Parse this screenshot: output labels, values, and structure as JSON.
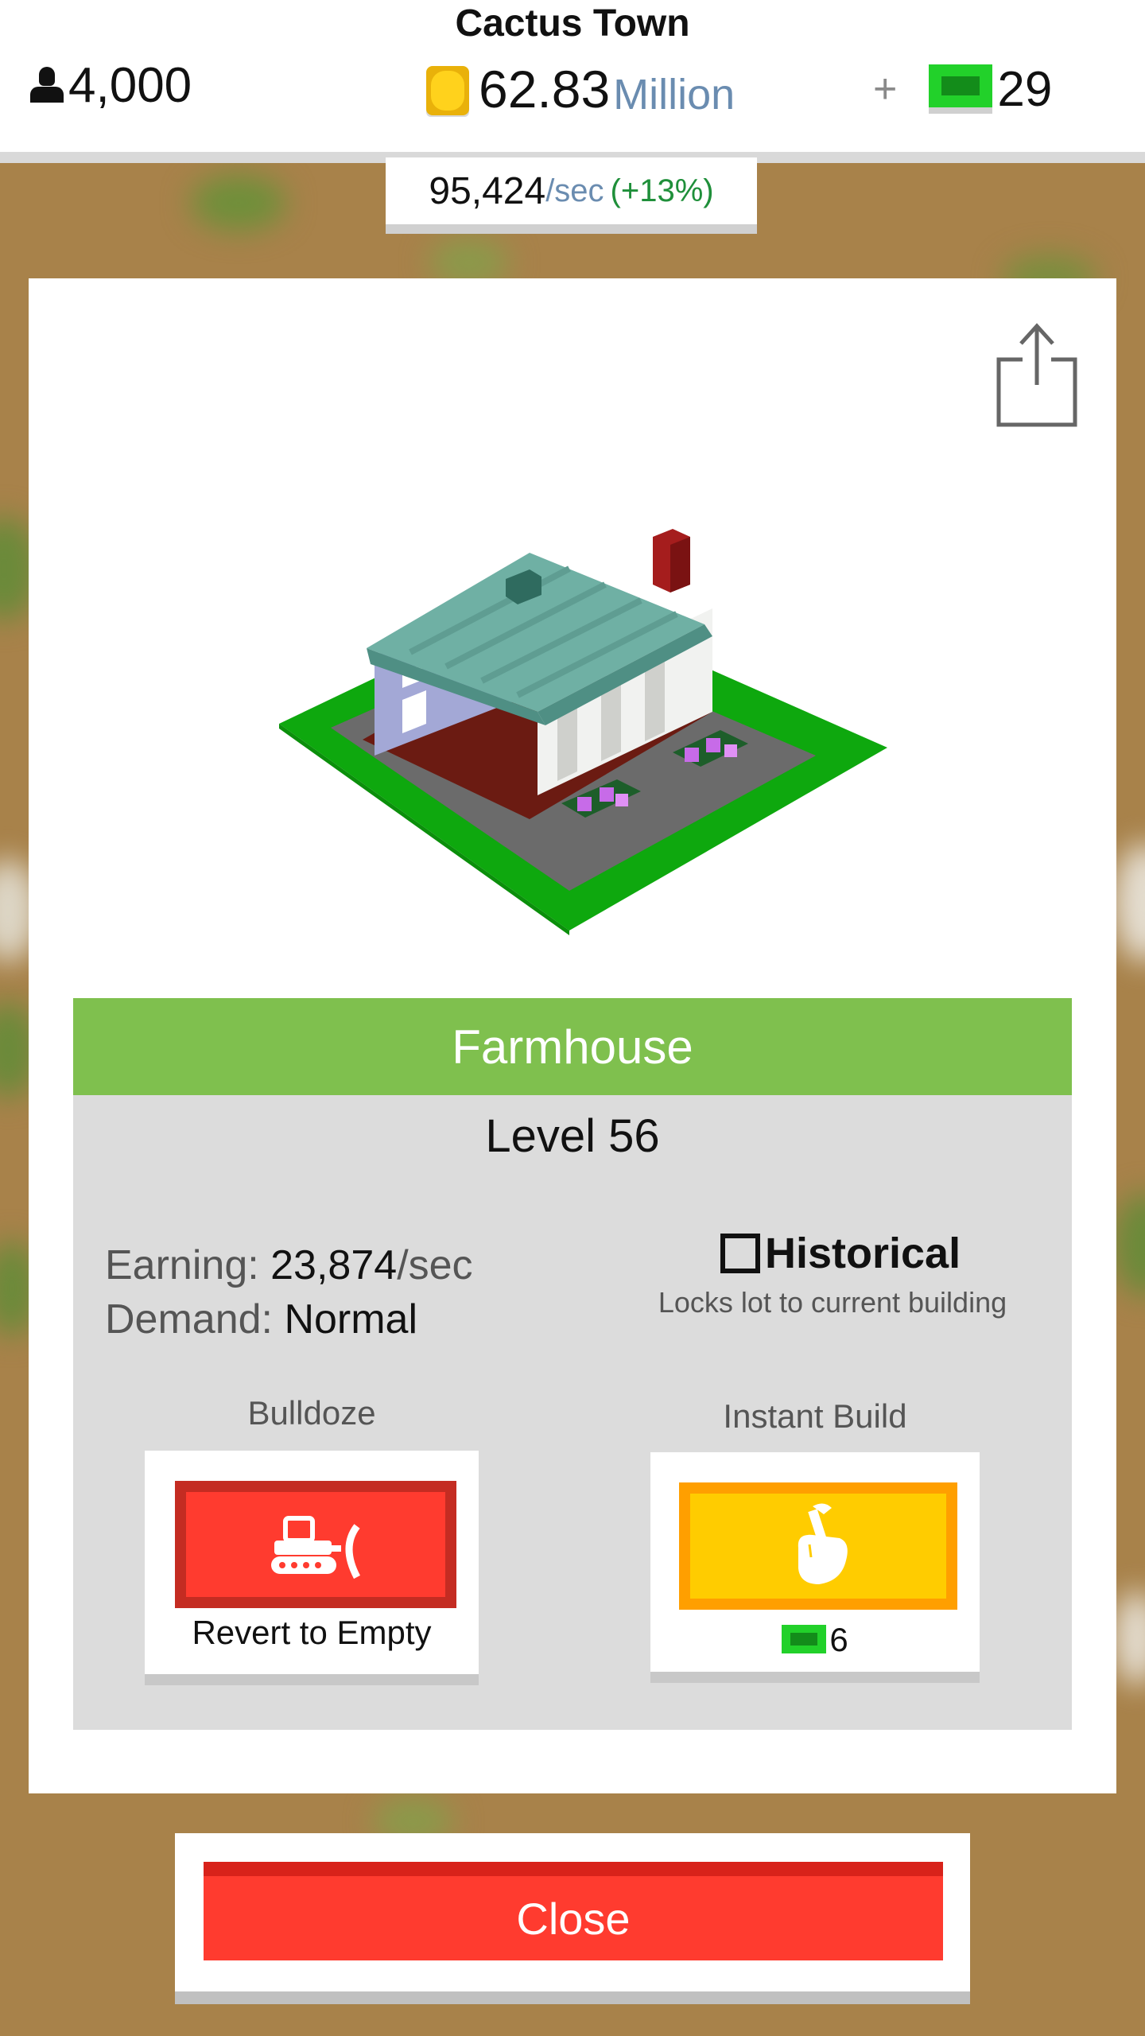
{
  "header": {
    "town_name": "Cactus Town",
    "population": "4,000",
    "population_icon": "person-icon",
    "money_value": "62.83",
    "money_unit": "Million",
    "money_icon": "coin-icon",
    "plus_label": "+",
    "cash_value": "29",
    "cash_icon": "cash-bill-icon",
    "rate_value": "95,424",
    "rate_unit": "/sec",
    "rate_change": "(+13%)"
  },
  "panel": {
    "share_icon": "share-icon",
    "building_name": "Farmhouse",
    "level_text": "Level 56",
    "earning_label": "Earning:",
    "earning_value": "23,874",
    "earning_unit": "/sec",
    "demand_label": "Demand:",
    "demand_value": "Normal",
    "historical_label": "Historical",
    "historical_checked": false,
    "historical_desc": "Locks lot to current building",
    "bulldoze": {
      "label": "Bulldoze",
      "caption": "Revert to Empty",
      "icon": "bulldozer-icon"
    },
    "instant_build": {
      "label": "Instant Build",
      "cost": "6",
      "icon": "hammer-hand-icon"
    }
  },
  "footer": {
    "close_label": "Close"
  },
  "colors": {
    "accent_green": "#7fc04e",
    "danger_red": "#ff3b2f",
    "gold": "#ffcc00",
    "cash_green": "#22d12a",
    "background_dirt": "#a8824a"
  }
}
